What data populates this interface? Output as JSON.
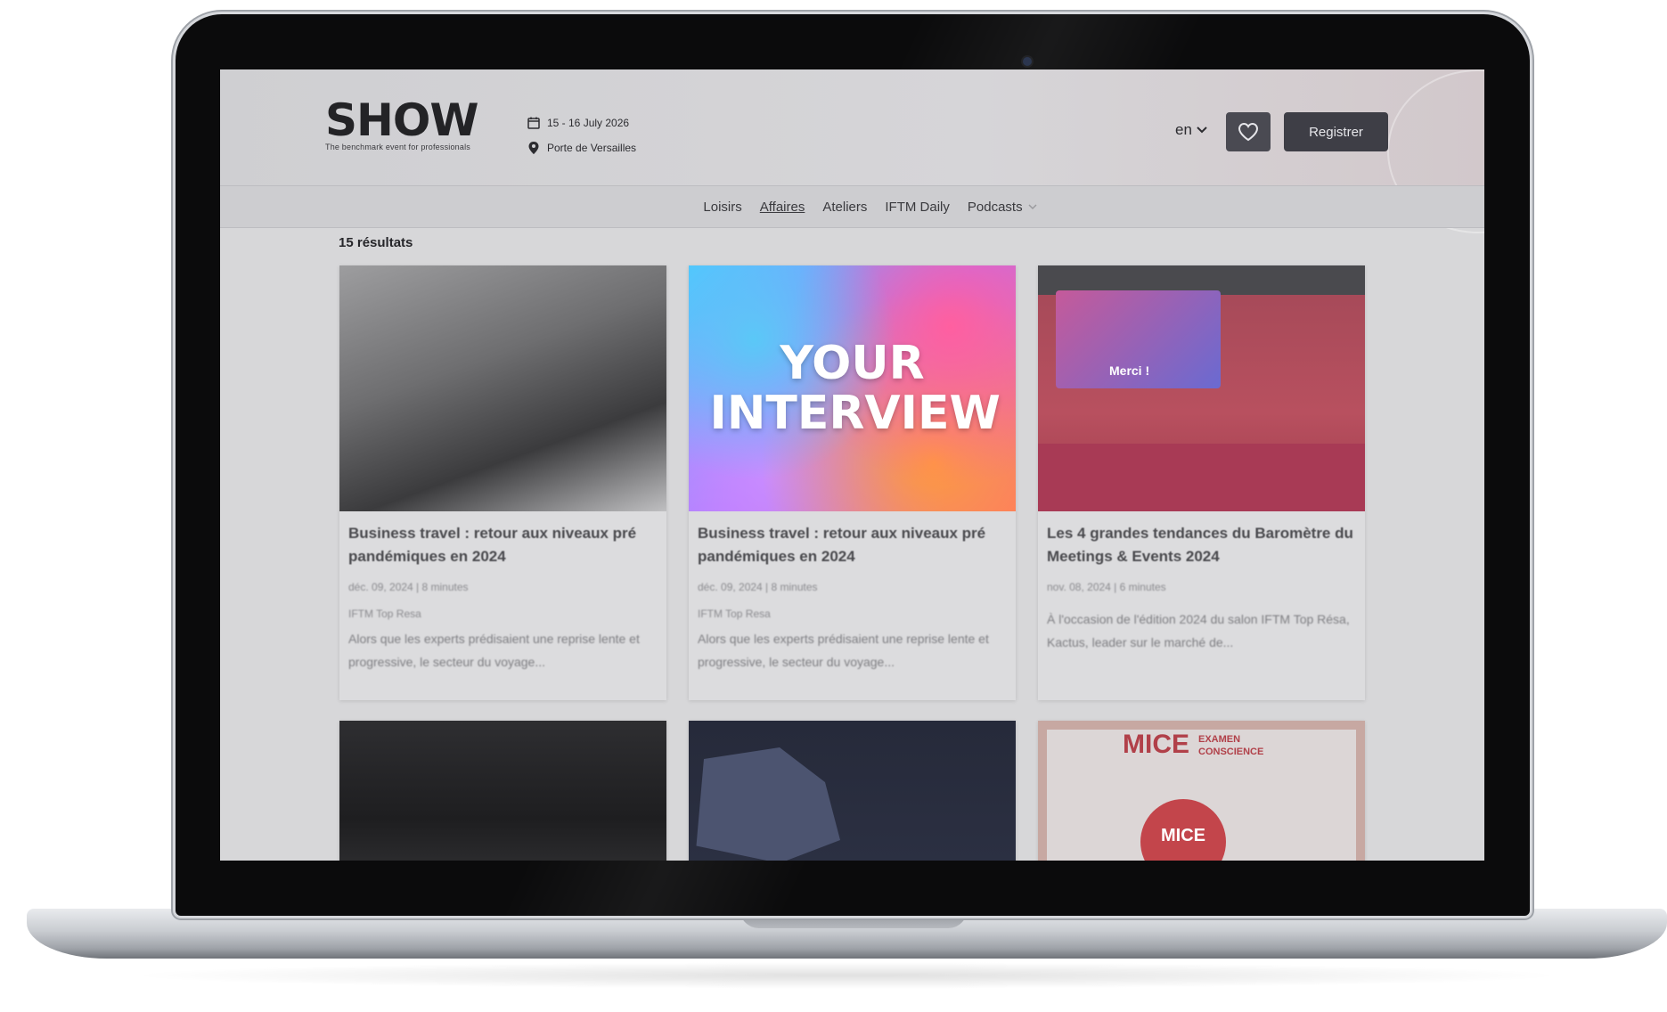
{
  "header": {
    "logo": "SHOW",
    "tagline": "The benchmark event for professionals",
    "date": "15 - 16 July 2026",
    "location": "Porte de Versailles",
    "lang": "en",
    "register_label": "Registrer"
  },
  "nav": {
    "items": [
      "Loisirs",
      "Affaires",
      "Ateliers",
      "IFTM Daily",
      "Podcasts"
    ]
  },
  "results_label": "15 résultats",
  "cards": [
    {
      "title": "Business travel : retour aux niveaux pré pandémiques en 2024",
      "meta": "déc. 09, 2024   |   8 minutes",
      "source": "IFTM Top Resa",
      "excerpt": "Alors que les experts prédisaient une reprise lente et progressive, le secteur du voyage..."
    },
    {
      "image_text": "YOUR INTERVIEW",
      "title": "Business travel : retour aux niveaux pré pandémiques en 2024",
      "meta": "déc. 09, 2024   |   8 minutes",
      "source": "IFTM Top Resa",
      "excerpt": "Alors que les experts prédisaient une reprise lente et progressive, le secteur du voyage..."
    },
    {
      "image_text": "Merci !",
      "title": "Les 4 grandes tendances du Baromètre du Meetings & Events 2024",
      "meta": "nov. 08, 2024   |   6 minutes",
      "excerpt": "À l'occasion de l'édition 2024 du salon IFTM Top Résa, Kactus, leader sur le marché de..."
    },
    {},
    {},
    {
      "image_title": "MICE",
      "image_sub": "EXAMEN CONSCIENCE",
      "image_badge": "MICE"
    }
  ],
  "colors": {
    "button_dark": "#3e3e46",
    "mice_red": "#c3454b"
  }
}
